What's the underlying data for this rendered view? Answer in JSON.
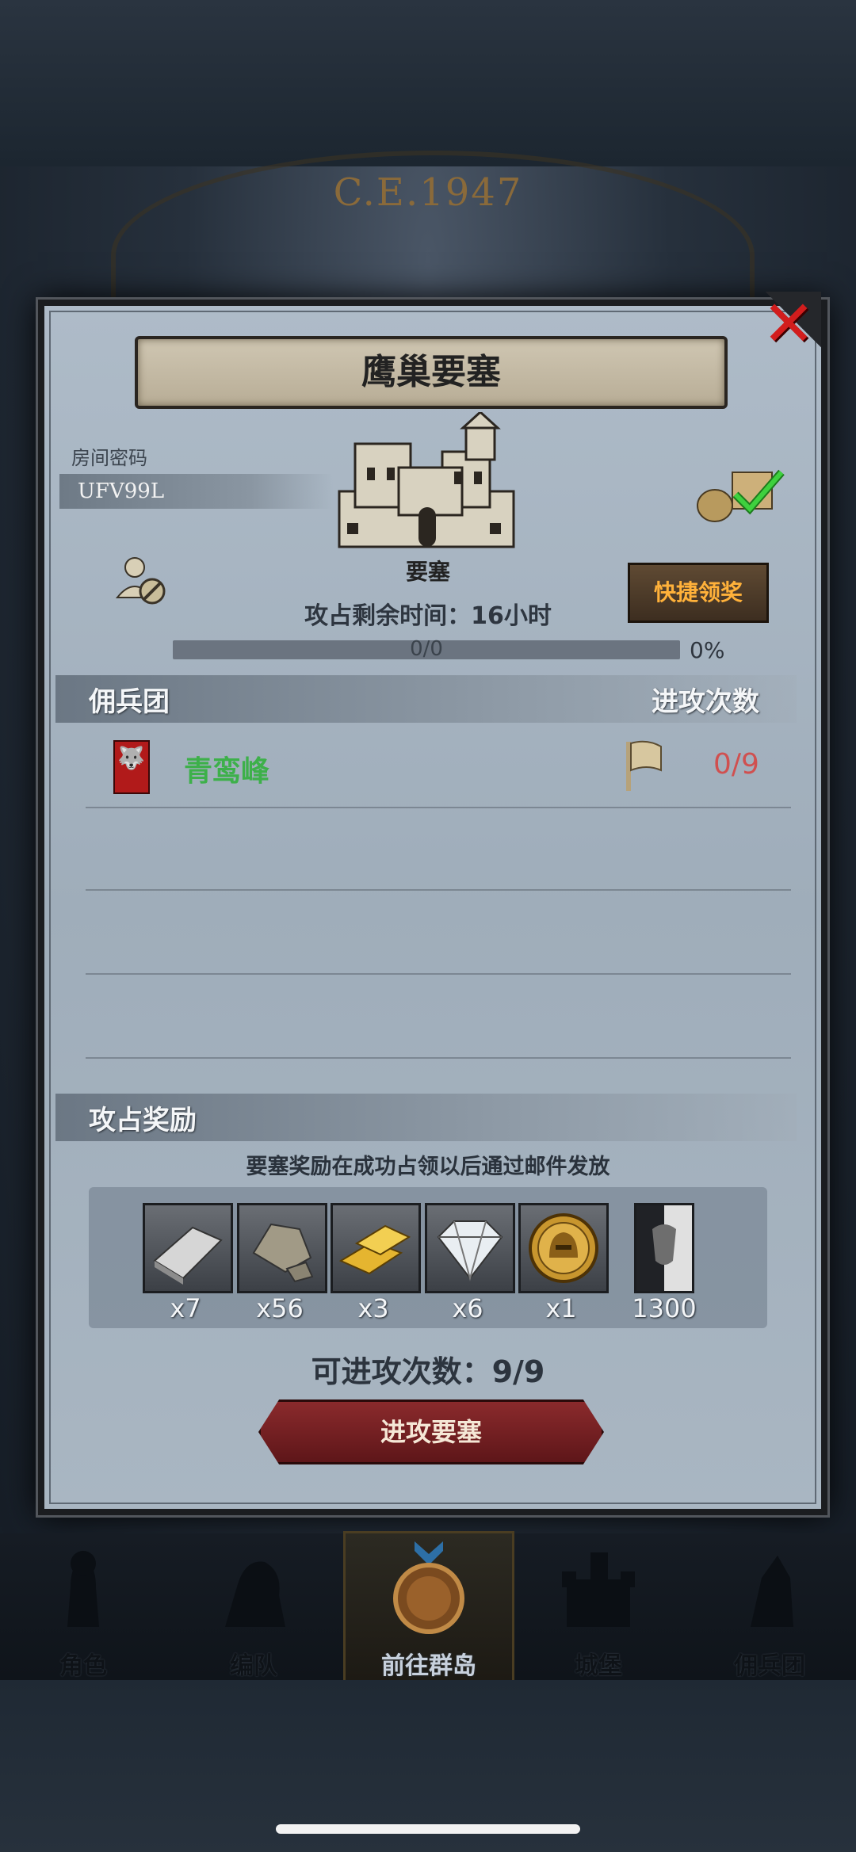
{
  "header": {
    "era": "C.E.1947"
  },
  "modal": {
    "title": "鹰巢要塞",
    "room_code_label": "房间密码",
    "room_code": "UFV99L",
    "fortress_label": "要塞",
    "time_remaining": "攻占剩余时间：16小时",
    "quick_claim_label": "快捷领奖",
    "progress_text": "0/0",
    "progress_percent": "0%",
    "progress_fraction": 0,
    "mercenary_header": "佣兵团",
    "attack_count_header": "进攻次数",
    "mercenaries": [
      {
        "name": "青鸾峰",
        "attack_count": "0/9"
      }
    ],
    "reward_header": "攻占奖励",
    "reward_note": "要塞奖励在成功占领以后通过邮件发放",
    "rewards": [
      {
        "icon": "silver-ingot-icon",
        "qty": "x7"
      },
      {
        "icon": "stone-ore-icon",
        "qty": "x56"
      },
      {
        "icon": "gold-bars-icon",
        "qty": "x3"
      },
      {
        "icon": "diamond-icon",
        "qty": "x6"
      },
      {
        "icon": "helmet-coin-icon",
        "qty": "x1"
      },
      {
        "icon": "honor-banner-icon",
        "qty": "1300"
      }
    ],
    "available_attacks": "可进攻次数：9/9",
    "attack_button_label": "进攻要塞"
  },
  "nav": {
    "items": [
      {
        "label": "角色",
        "icon": "knight-icon",
        "active": false
      },
      {
        "label": "编队",
        "icon": "warrior-icon",
        "active": false
      },
      {
        "label": "前往群岛",
        "icon": "compass-icon",
        "active": true
      },
      {
        "label": "城堡",
        "icon": "castle-icon",
        "active": false
      },
      {
        "label": "佣兵团",
        "icon": "mercenary-icon",
        "active": false
      }
    ]
  },
  "colors": {
    "accent_red": "#d21d1d",
    "merc_name_green": "#3db04a",
    "attack_count_red": "#d05050",
    "quick_claim_orange": "#ffb13a"
  }
}
